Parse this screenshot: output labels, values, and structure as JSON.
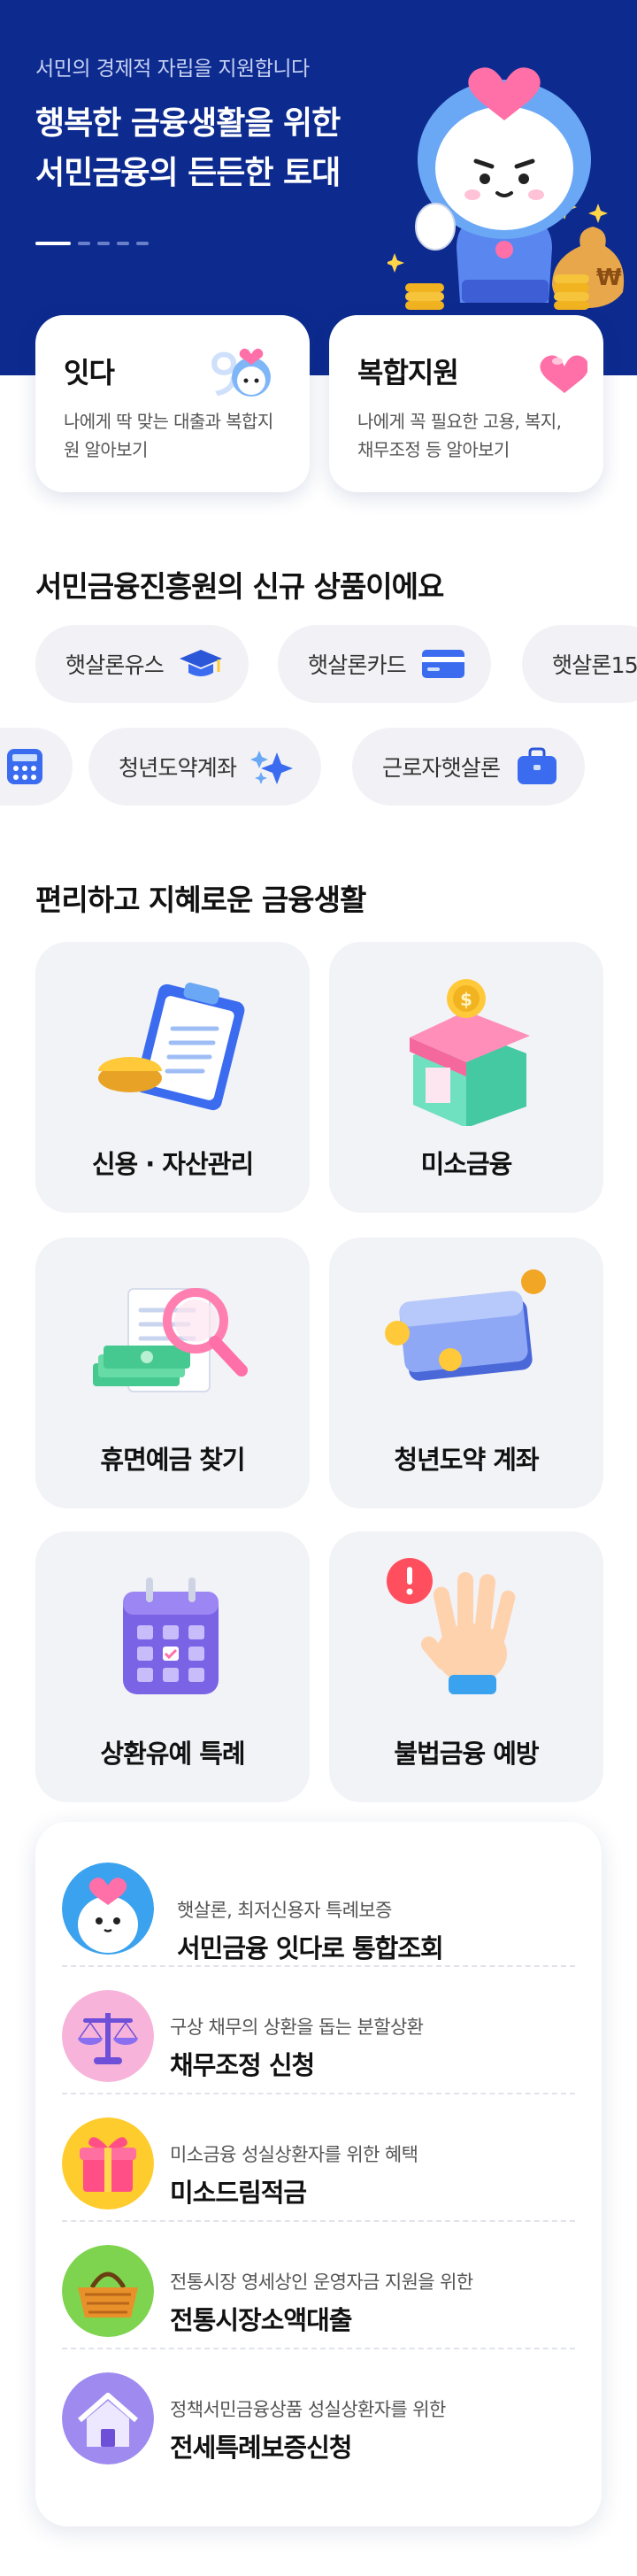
{
  "hero": {
    "subtitle": "서민의 경제적 자립을 지원합니다",
    "title_line1": "행복한 금융생활을 위한",
    "title_line2": "서민금융의 든든한 토대",
    "bg_color": "#0d2b8f",
    "slide_count": 5,
    "active_slide": 1
  },
  "top_cards": [
    {
      "title": "잇다",
      "desc": "나에게 딱 맞는 대출과 복합지원 알아보기",
      "icon": "mascot-ita-logo-icon"
    },
    {
      "title": "복합지원",
      "desc": "나에게 꼭 필요한 고용, 복지, 채무조정 등 알아보기",
      "icon": "heart-icon"
    }
  ],
  "new_products": {
    "title": "서민금융진흥원의 신규 상품이에요",
    "row1": [
      {
        "label": "햇살론유스",
        "icon": "graduation-cap-icon"
      },
      {
        "label": "햇살론카드",
        "icon": "credit-card-icon"
      },
      {
        "label": "햇살론15",
        "icon": ""
      }
    ],
    "row2": [
      {
        "label": "",
        "icon": "calculator-icon"
      },
      {
        "label": "청년도약계좌",
        "icon": "sparkle-icon"
      },
      {
        "label": "근로자햇살론",
        "icon": "briefcase-icon"
      }
    ]
  },
  "services": {
    "title": "편리하고 지혜로운 금융생활",
    "items": [
      {
        "label": "신용 · 자산관리",
        "icon": "clipboard-chart-icon"
      },
      {
        "label": "미소금융",
        "icon": "store-coin-icon"
      },
      {
        "label": "휴면예금 찾기",
        "icon": "magnifier-money-icon"
      },
      {
        "label": "청년도약 계좌",
        "icon": "wallet-coins-icon"
      },
      {
        "label": "상환유예 특례",
        "icon": "calendar-icon"
      },
      {
        "label": "불법금융 예방",
        "icon": "warning-hand-icon"
      }
    ]
  },
  "list": [
    {
      "desc": "햇살론, 최저신용자 특례보증",
      "title": "서민금융 잇다로 통합조회",
      "icon": "mascot-avatar-icon",
      "color": "#3aa2ee"
    },
    {
      "desc": "구상 채무의 상환을 돕는 분할상환",
      "title": "채무조정 신청",
      "icon": "scale-icon",
      "color": "#f7b3d9"
    },
    {
      "desc": "미소금융 성실상환자를 위한 혜택",
      "title": "미소드림적금",
      "icon": "gift-icon",
      "color": "#ffcc2e"
    },
    {
      "desc": "전통시장 영세상인 운영자금 지원을 위한",
      "title": "전통시장소액대출",
      "icon": "basket-icon",
      "color": "#7ed44e"
    },
    {
      "desc": "정책서민금융상품 성실상환자를 위한",
      "title": "전세특례보증신청",
      "icon": "house-icon",
      "color": "#9f8bf0"
    }
  ]
}
